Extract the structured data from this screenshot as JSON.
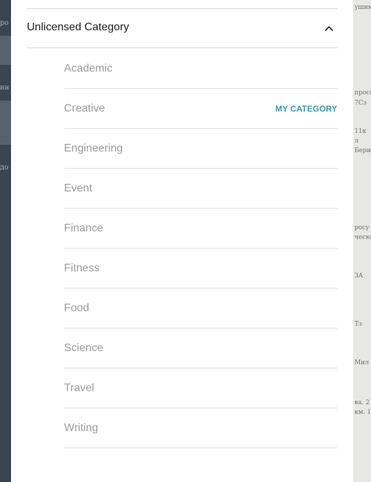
{
  "modal": {
    "section_title": "Unlicensed Category",
    "collapse_icon": "chevron-up-icon",
    "accent_color": "#2d9cb4",
    "categories": [
      {
        "label": "Academic",
        "tag": ""
      },
      {
        "label": "Creative",
        "tag": "MY CATEGORY"
      },
      {
        "label": "Engineering",
        "tag": ""
      },
      {
        "label": "Event",
        "tag": ""
      },
      {
        "label": "Finance",
        "tag": ""
      },
      {
        "label": "Fitness",
        "tag": ""
      },
      {
        "label": "Food",
        "tag": ""
      },
      {
        "label": "Science",
        "tag": ""
      },
      {
        "label": "Travel",
        "tag": ""
      },
      {
        "label": "Writing",
        "tag": ""
      }
    ]
  },
  "background": {
    "left_fragments": [
      "ро",
      "ин",
      "до"
    ],
    "right_fragments": [
      "ушим",
      "просы",
      "7Сз",
      "11к",
      "л",
      "Бериа",
      "росу",
      "ческо",
      "ЗА",
      "Тз",
      "Мил",
      "ва. 2",
      "км. 1"
    ]
  }
}
